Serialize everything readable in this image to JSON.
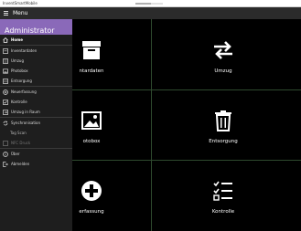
{
  "window": {
    "title": "InventSmartMobile",
    "progress_fraction": 0.55
  },
  "header": {
    "menu_label": "Menu"
  },
  "sidebar": {
    "user": "Administrator",
    "items": [
      {
        "label": "Home",
        "icon": "home-icon",
        "active": true
      },
      {
        "label": "Inventardaten",
        "icon": "inventory-icon"
      },
      {
        "label": "Umzug",
        "icon": "move-icon"
      },
      {
        "label": "Photobox",
        "icon": "photo-icon"
      },
      {
        "label": "Entsorgung",
        "icon": "disposal-icon"
      },
      {
        "label": "Neuerfassung",
        "icon": "add-icon"
      },
      {
        "label": "Kontrolle",
        "icon": "checklist-icon"
      },
      {
        "label": "Umzug in Raum",
        "icon": "move-room-icon"
      },
      {
        "label": "Synchronisation",
        "icon": "sync-icon"
      },
      {
        "label": "Tag Scan",
        "icon": "",
        "sub": true
      },
      {
        "label": "NFC Druck",
        "icon": "nfc-print-icon",
        "disabled": true
      },
      {
        "label": "Über",
        "icon": "info-icon"
      },
      {
        "label": "Abmelden",
        "icon": "logout-icon"
      }
    ]
  },
  "tiles": [
    {
      "label": "ntardaten",
      "icon": "box-icon"
    },
    {
      "label": "Umzug",
      "icon": "swap-arrows-icon"
    },
    {
      "label": "otobox",
      "icon": "photo-icon"
    },
    {
      "label": "Entsorgung",
      "icon": "trash-icon"
    },
    {
      "label": "erfassung",
      "icon": "add-circle-icon"
    },
    {
      "label": "Kontrolle",
      "icon": "checklist-icon"
    }
  ]
}
